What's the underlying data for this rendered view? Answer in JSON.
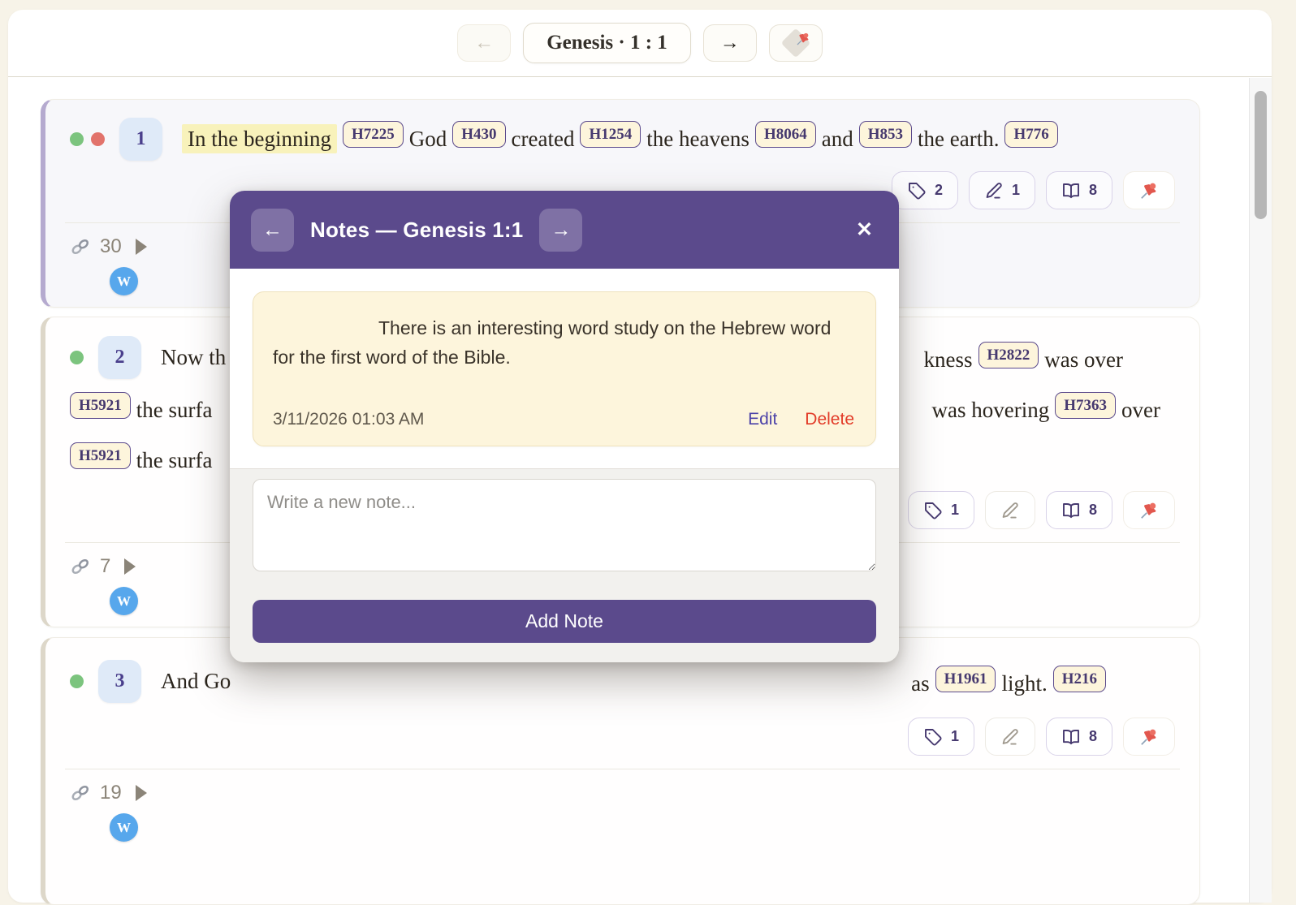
{
  "topbar": {
    "back_label": "←",
    "reference": "Genesis · 1 : 1",
    "forward_label": "→"
  },
  "verses": [
    {
      "number": "1",
      "words": {
        "w1": "In the beginning",
        "b1": "H7225",
        "w2": "God",
        "b2": "H430",
        "w3": "created",
        "b3": "H1254",
        "w4": "the heavens",
        "b4": "H8064",
        "w5": "and",
        "b5": "H853",
        "w6": "the earth.",
        "b6": "H776"
      },
      "tag_count": "2",
      "note_count": "1",
      "ref_count": "8",
      "link_count": "30"
    },
    {
      "number": "2",
      "line1_left": "Now th",
      "line1_right_a": "kness",
      "line1_badge": "H2822",
      "line1_right_b": "was over",
      "line2_badge_left": "H5921",
      "line2_left": "the surfa",
      "line2_right_a": "was hovering",
      "line2_badge": "H7363",
      "line2_right_b": "over",
      "line3_badge_left": "H5921",
      "line3_left": "the surfa",
      "tag_count": "1",
      "ref_count": "8",
      "link_count": "7"
    },
    {
      "number": "3",
      "line1_left": "And Go",
      "line1_right_a": "as",
      "line1_badge": "H1961",
      "line1_right_b": "light.",
      "line1_badge2": "H216",
      "tag_count": "1",
      "ref_count": "8",
      "link_count": "19"
    }
  ],
  "wiki_label": "W",
  "modal": {
    "title": "Notes — Genesis 1:1",
    "back_label": "←",
    "forward_label": "→",
    "close_label": "✕",
    "note": {
      "text": "There is an interesting word study on the Hebrew word for the first word of the Bible.",
      "timestamp": "3/11/2026 01:03 AM",
      "edit_label": "Edit",
      "delete_label": "Delete"
    },
    "composer_placeholder": "Write a new note...",
    "add_button": "Add Note"
  },
  "colors": {
    "accent_purple": "#5b4a8c",
    "note_bg": "#fdf5dc",
    "highlight_yellow": "#f8f2bb",
    "status_green": "#7cc47e",
    "status_red": "#e2736b",
    "wiki_blue": "#57a7ec",
    "edit_link": "#4c42a8",
    "delete_link": "#e23b28",
    "page_bg": "#f7f3e8"
  }
}
